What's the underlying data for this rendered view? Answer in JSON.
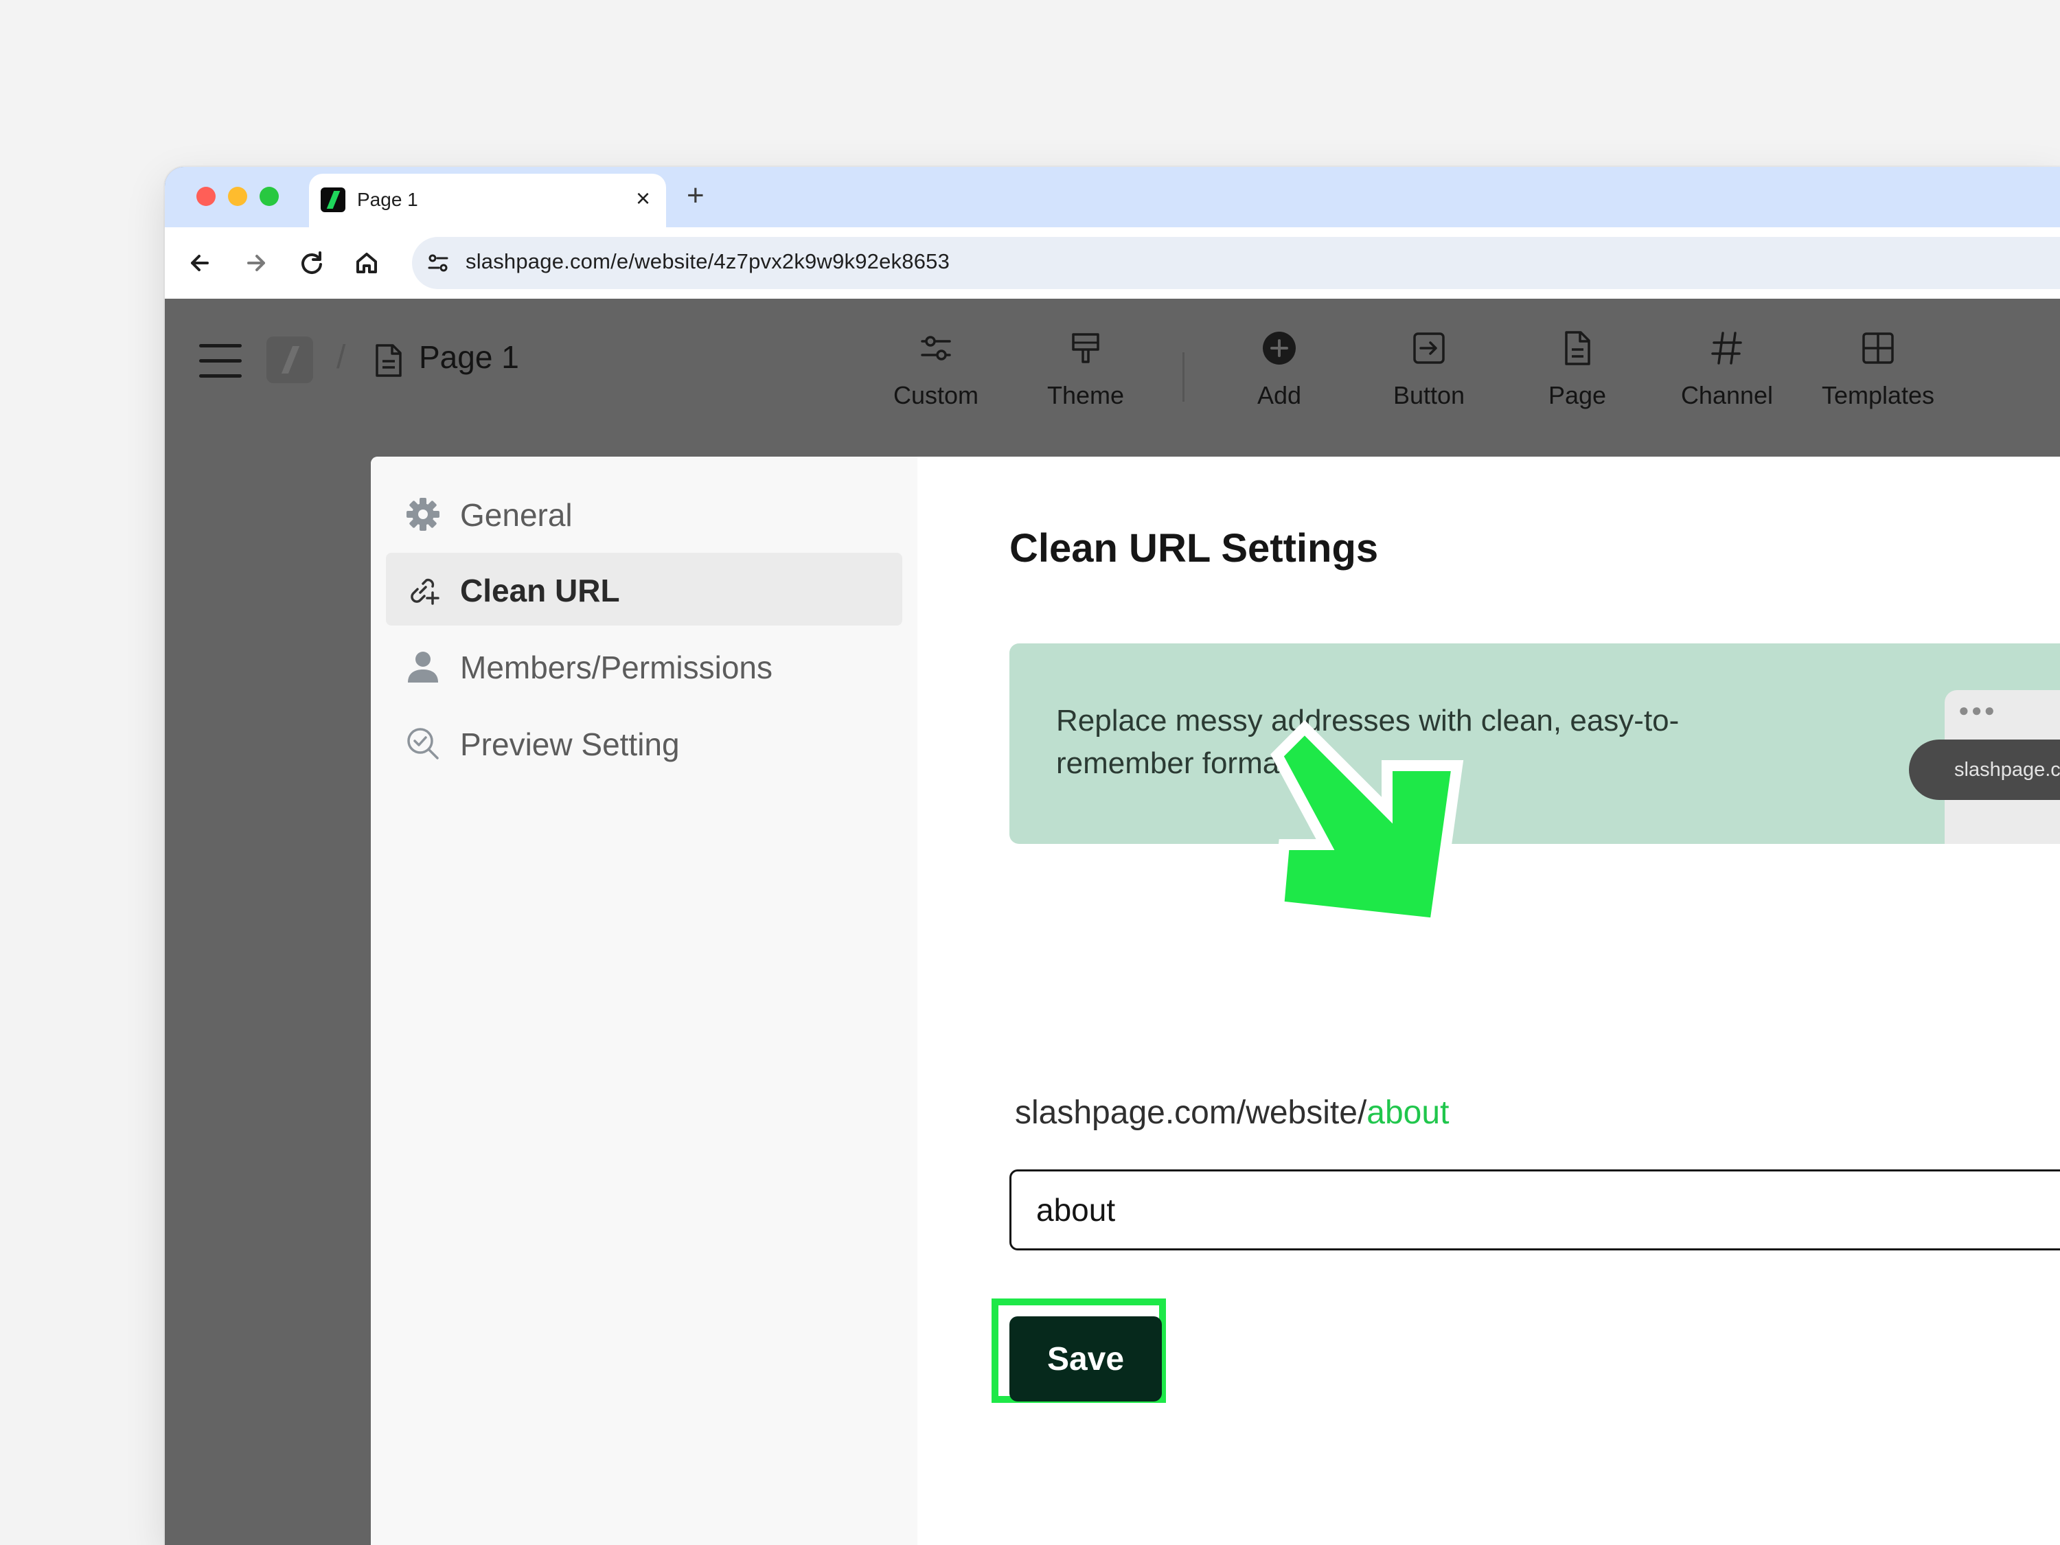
{
  "browser": {
    "tab_title": "Page 1",
    "tab_close": "×",
    "new_tab": "+",
    "url": "slashpage.com/e/website/4z7pvx2k9w9k92ek8653"
  },
  "header": {
    "breadcrumb_separator": "/",
    "page_title": "Page 1",
    "tools": [
      {
        "label": "Custom",
        "icon": "sliders-icon"
      },
      {
        "label": "Theme",
        "icon": "paint-brush-icon"
      },
      {
        "label": "Add",
        "icon": "plus-circle-icon"
      },
      {
        "label": "Button",
        "icon": "button-arrow-icon"
      },
      {
        "label": "Page",
        "icon": "document-icon"
      },
      {
        "label": "Channel",
        "icon": "hash-icon"
      },
      {
        "label": "Templates",
        "icon": "layout-icon"
      }
    ]
  },
  "sidebar": {
    "items": [
      {
        "label": "General",
        "icon": "gear-icon",
        "active": false
      },
      {
        "label": "Clean URL",
        "icon": "link-icon",
        "active": true
      },
      {
        "label": "Members/Permissions",
        "icon": "user-icon",
        "active": false
      },
      {
        "label": "Preview Setting",
        "icon": "search-check-icon",
        "active": false
      }
    ]
  },
  "main": {
    "title": "Clean URL Settings",
    "banner_text": "Replace messy addresses with clean, easy-to-remember formats",
    "banner_mock_url": "slashpage.com",
    "url_prefix": "slashpage.com/website/",
    "url_slug": "about",
    "slug_value": "about",
    "save_label": "Save"
  },
  "colors": {
    "accent_green": "#1ee848",
    "slug_green": "#20c64c",
    "save_bg": "#06291c",
    "banner_bg": "#bedfcf",
    "tabstrip": "#d3e3fd"
  }
}
